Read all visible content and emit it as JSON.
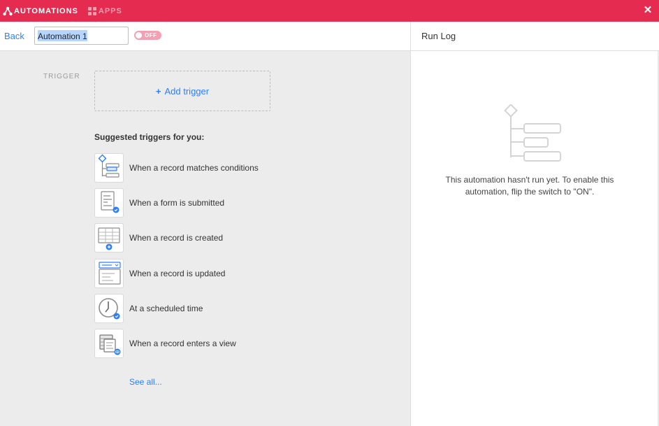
{
  "topbar": {
    "automations_label": "AUTOMATIONS",
    "apps_label": "APPS",
    "close_icon": "close-icon",
    "bg_color": "#e52b4f"
  },
  "header": {
    "back_label": "Back",
    "automation_name": "Automation 1",
    "toggle_label": "OFF",
    "toggle_state": "off",
    "run_log_title": "Run Log"
  },
  "trigger": {
    "section_label": "TRIGGER",
    "add_trigger_label": "Add trigger",
    "suggested_title": "Suggested triggers for you:",
    "suggestions": [
      {
        "label": "When a record matches conditions",
        "icon": "conditions-icon"
      },
      {
        "label": "When a form is submitted",
        "icon": "form-icon"
      },
      {
        "label": "When a record is created",
        "icon": "record-created-icon"
      },
      {
        "label": "When a record is updated",
        "icon": "record-updated-icon"
      },
      {
        "label": "At a scheduled time",
        "icon": "clock-icon"
      },
      {
        "label": "When a record enters a view",
        "icon": "view-icon"
      }
    ],
    "see_all_label": "See all..."
  },
  "run_log": {
    "empty_message": "This automation hasn't run yet. To enable this automation, flip the switch to \"ON\"."
  },
  "colors": {
    "accent_blue": "#2d7ff9",
    "brand_red": "#e52b4f"
  }
}
